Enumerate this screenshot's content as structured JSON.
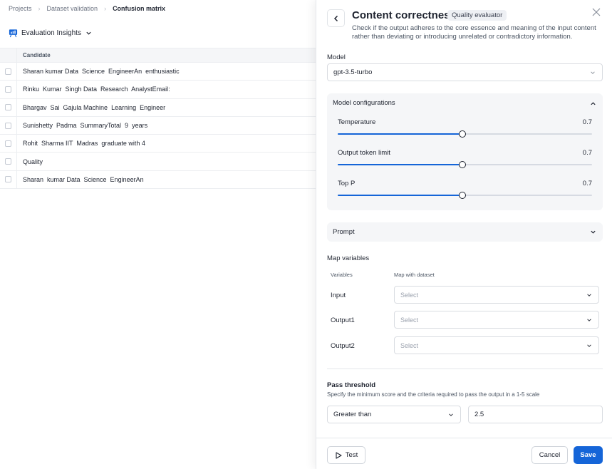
{
  "breadcrumb": {
    "items": [
      "Projects",
      "Dataset validation",
      "Confusion matrix"
    ]
  },
  "insights": {
    "label": "Evaluation Insights",
    "icon": "presentation-chart-icon"
  },
  "table": {
    "header": "Candidate",
    "rows": [
      "Sharan kumar Data  Science  EngineerAn  enthusiastic",
      "Rinku  Kumar  Singh Data  Research  AnalystEmail:",
      "Bhargav  Sai  Gajula Machine  Learning  Engineer",
      "Sunishetty  Padma  SummaryTotal  9  years",
      "Rohit  Sharma IIT  Madras  graduate with 4",
      "Quality",
      "Sharan  kumar Data  Science  EngineerAn"
    ]
  },
  "panel": {
    "title": "Content correctness",
    "badge": "Quality evaluator",
    "description": "Check if the output adheres to the core essence and meaning of the input content rather than deviating or introducing unrelated or contradictory information.",
    "model_label": "Model",
    "model_value": "gpt-3.5-turbo",
    "config_title": "Model configurations",
    "sliders": [
      {
        "label": "Temperature",
        "value": "0.7",
        "fraction": 0.49
      },
      {
        "label": "Output token limit",
        "value": "0.7",
        "fraction": 0.49
      },
      {
        "label": "Top P",
        "value": "0.7",
        "fraction": 0.49
      }
    ],
    "prompt_title": "Prompt",
    "map_title": "Map variables",
    "map_col_variables": "Variables",
    "map_col_dataset": "Map with dataset",
    "variables": [
      {
        "name": "Input",
        "placeholder": "Select"
      },
      {
        "name": "Output1",
        "placeholder": "Select"
      },
      {
        "name": "Output2",
        "placeholder": "Select"
      }
    ],
    "pass_title": "Pass threshold",
    "pass_desc": "Specify the minimum score and the criteria required to pass the output in a 1-5 scale",
    "comparator": "Greater than",
    "score": "2.5",
    "test_label": "Test",
    "cancel_label": "Cancel",
    "save_label": "Save"
  },
  "colors": {
    "accent": "#1565d8"
  }
}
